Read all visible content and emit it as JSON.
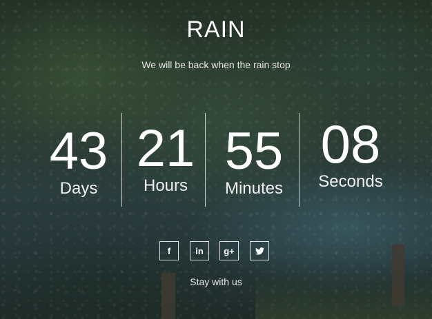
{
  "page": {
    "title": "RAIN",
    "subtitle": "We will be back when the rain stop"
  },
  "countdown": {
    "days": {
      "value": "43",
      "label": "Days"
    },
    "hours": {
      "value": "21",
      "label": "Hours"
    },
    "minutes": {
      "value": "55",
      "label": "Minutes"
    },
    "seconds": {
      "value": "08",
      "label": "Seconds"
    }
  },
  "social": {
    "icons": [
      "facebook-icon",
      "linkedin-icon",
      "google-plus-icon",
      "twitter-icon"
    ],
    "facebook_glyph": "f",
    "linkedin_glyph": "in",
    "google_plus_glyph": "g+"
  },
  "footer": {
    "tagline": "Stay with us"
  },
  "colors": {
    "text": "#ffffff",
    "background": "#2a3c33"
  }
}
